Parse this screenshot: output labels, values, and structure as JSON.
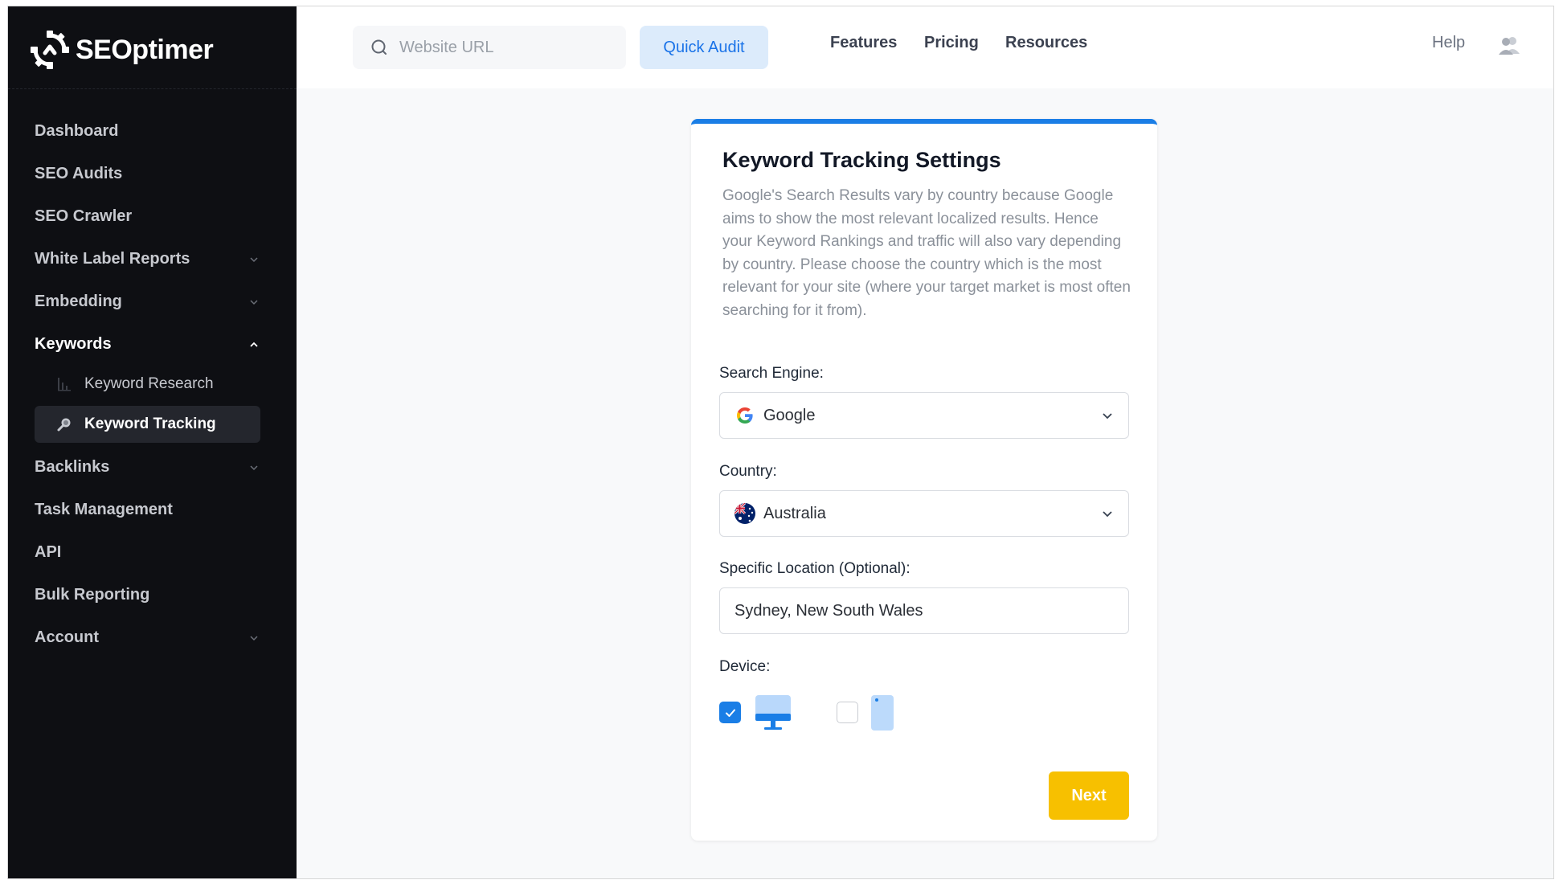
{
  "brand": {
    "name": "SEOptimer"
  },
  "sidebar": {
    "items": [
      {
        "label": "Dashboard"
      },
      {
        "label": "SEO Audits"
      },
      {
        "label": "SEO Crawler"
      },
      {
        "label": "White Label Reports"
      },
      {
        "label": "Embedding"
      },
      {
        "label": "Keywords"
      },
      {
        "label": "Backlinks"
      },
      {
        "label": "Task Management"
      },
      {
        "label": "API"
      },
      {
        "label": "Bulk Reporting"
      },
      {
        "label": "Account"
      }
    ],
    "keywords_sub": [
      {
        "label": "Keyword Research",
        "icon": "bar-chart-icon"
      },
      {
        "label": "Keyword Tracking",
        "icon": "magnifier-icon"
      }
    ]
  },
  "topbar": {
    "search_placeholder": "Website URL",
    "quick_audit_label": "Quick Audit",
    "links": [
      "Features",
      "Pricing",
      "Resources"
    ],
    "help_label": "Help"
  },
  "card": {
    "title": "Keyword Tracking Settings",
    "description": "Google's Search Results vary by country because Google aims to show the most relevant localized results. Hence your Keyword Rankings and traffic will also vary depending by country. Please choose the country which is the most relevant for your site (where your target market is most often searching for it from).",
    "search_engine_label": "Search Engine:",
    "search_engine_value": "Google",
    "country_label": "Country:",
    "country_value": "Australia",
    "location_label": "Specific Location (Optional):",
    "location_value": "Sydney, New South Wales",
    "device_label": "Device:",
    "devices": [
      {
        "name": "desktop",
        "checked": true
      },
      {
        "name": "mobile",
        "checked": false
      }
    ],
    "next_label": "Next"
  },
  "colors": {
    "sidebar_bg": "#0e0f13",
    "accent_blue": "#1a7ee6",
    "next_yellow": "#f7c000",
    "quick_audit_bg": "#dcebfb"
  }
}
